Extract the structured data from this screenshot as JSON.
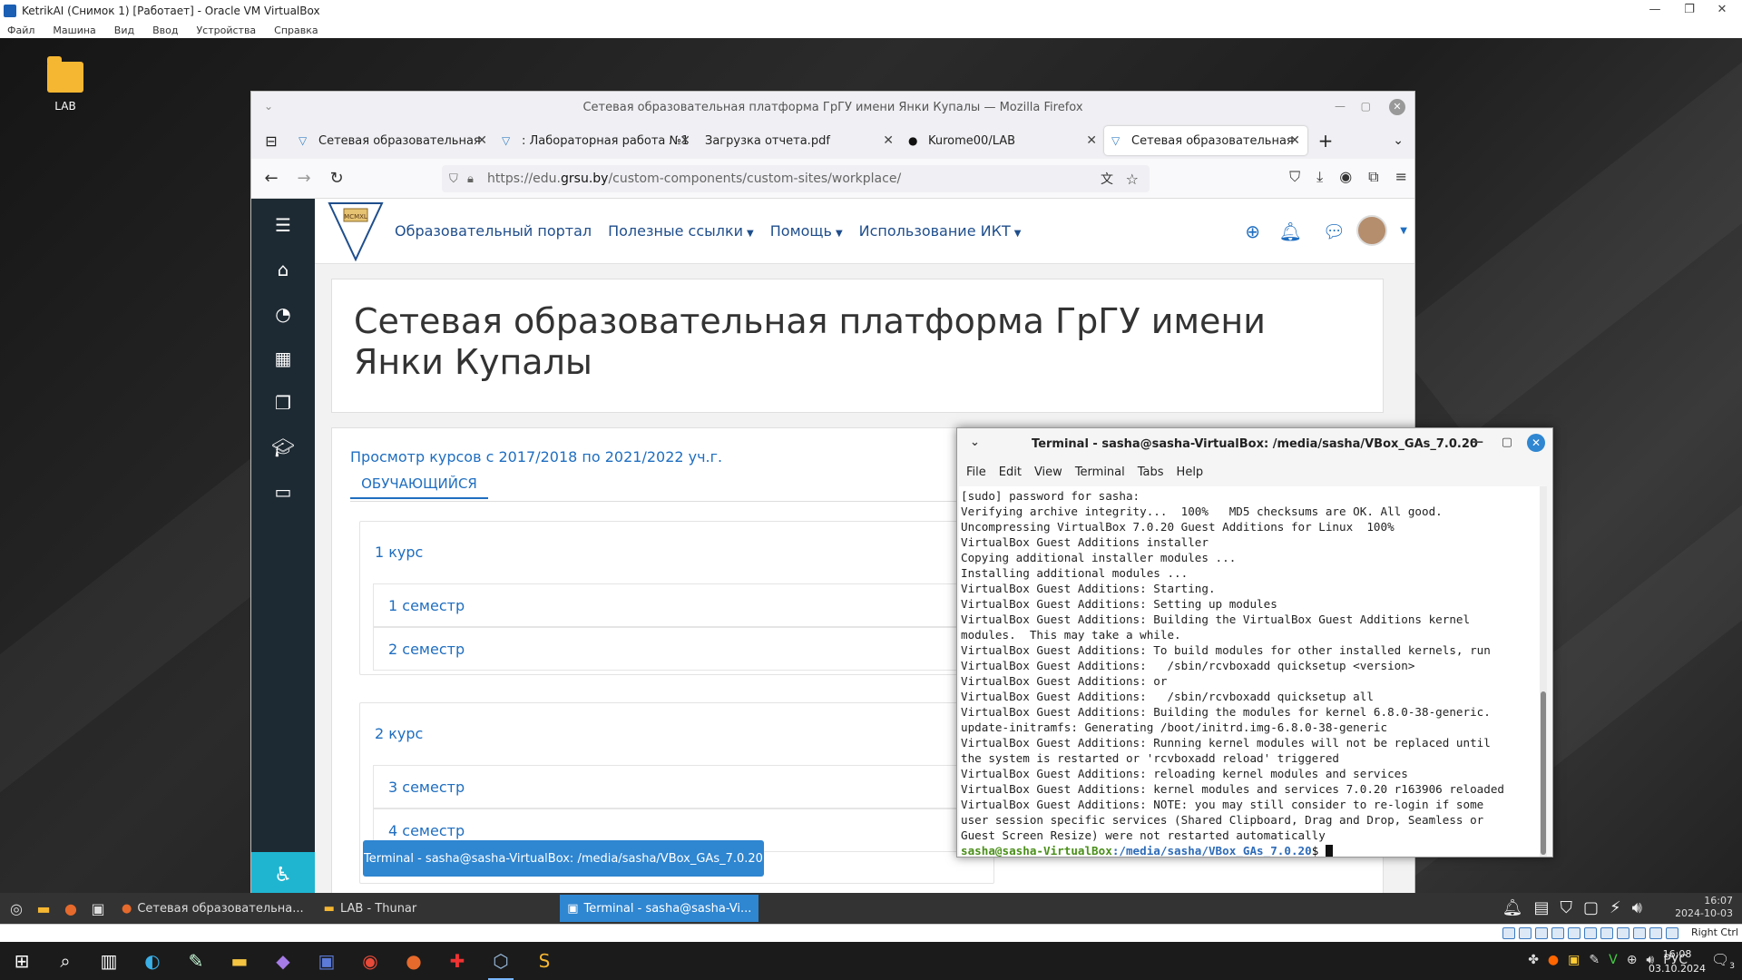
{
  "vbox": {
    "title": "KetrikAI (Снимок 1) [Работает] - Oracle VM VirtualBox",
    "menu": [
      "Файл",
      "Машина",
      "Вид",
      "Ввод",
      "Устройства",
      "Справка"
    ],
    "host_key": "Right Ctrl"
  },
  "desktop": {
    "icon_label": "LAB"
  },
  "firefox": {
    "window_title": "Сетевая образовательная платформа ГрГУ имени Янки Купалы — Mozilla Firefox",
    "tabs": [
      {
        "label": "Сетевая образовательная"
      },
      {
        "label": ": Лабораторная работа №1"
      },
      {
        "label": "Загрузка отчета.pdf"
      },
      {
        "label": "Kurome00/LAB"
      },
      {
        "label": "Сетевая образовательная"
      }
    ],
    "url_prefix": "https://edu.",
    "url_domain": "grsu.by",
    "url_path": "/custom-components/custom-sites/workplace/"
  },
  "site": {
    "logo_text": "MCMXL",
    "nav": [
      {
        "label": "Образовательный портал",
        "dropdown": false
      },
      {
        "label": "Полезные ссылки",
        "dropdown": true
      },
      {
        "label": "Помощь",
        "dropdown": true
      },
      {
        "label": "Использование ИКТ",
        "dropdown": true
      }
    ],
    "page_title": "Сетевая образовательная платформа ГрГУ имени Янки Купалы",
    "view_courses_link": "Просмотр курсов с 2017/2018 по 2021/2022 уч.г.",
    "tab_label": "ОБУЧАЮЩИЙСЯ",
    "courses": [
      {
        "title": "1 курс",
        "semesters": [
          "1 семестр",
          "2 семестр"
        ]
      },
      {
        "title": "2 курс",
        "semesters": [
          "3 семестр",
          "4 семестр"
        ]
      }
    ]
  },
  "terminal": {
    "title": "Terminal - sasha@sasha-VirtualBox: /media/sasha/VBox_GAs_7.0.20",
    "menu": [
      "File",
      "Edit",
      "View",
      "Terminal",
      "Tabs",
      "Help"
    ],
    "output": "[sudo] password for sasha:\nVerifying archive integrity...  100%   MD5 checksums are OK. All good.\nUncompressing VirtualBox 7.0.20 Guest Additions for Linux  100%\nVirtualBox Guest Additions installer\nCopying additional installer modules ...\nInstalling additional modules ...\nVirtualBox Guest Additions: Starting.\nVirtualBox Guest Additions: Setting up modules\nVirtualBox Guest Additions: Building the VirtualBox Guest Additions kernel\nmodules.  This may take a while.\nVirtualBox Guest Additions: To build modules for other installed kernels, run\nVirtualBox Guest Additions:   /sbin/rcvboxadd quicksetup <version>\nVirtualBox Guest Additions: or\nVirtualBox Guest Additions:   /sbin/rcvboxadd quicksetup all\nVirtualBox Guest Additions: Building the modules for kernel 6.8.0-38-generic.\nupdate-initramfs: Generating /boot/initrd.img-6.8.0-38-generic\nVirtualBox Guest Additions: Running kernel modules will not be replaced until\nthe system is restarted or 'rcvboxadd reload' triggered\nVirtualBox Guest Additions: reloading kernel modules and services\nVirtualBox Guest Additions: kernel modules and services 7.0.20 r163906 reloaded\nVirtualBox Guest Additions: NOTE: you may still consider to re-login if some\nuser session specific services (Shared Clipboard, Drag and Drop, Seamless or\nGuest Screen Resize) were not restarted automatically",
    "prompt_user": "sasha@sasha-VirtualBox",
    "prompt_path": ":/media/sasha/VBox_GAs_7.0.20",
    "prompt_sym": "$"
  },
  "tooltip": "Terminal - sasha@sasha-VirtualBox: /media/sasha/VBox_GAs_7.0.20",
  "guest_panel": {
    "tasks": [
      "Сетевая образовательна...",
      "LAB - Thunar",
      "Terminal - sasha@sasha-Vi..."
    ],
    "time": "16:07",
    "date": "2024-10-03"
  },
  "windows_taskbar": {
    "lang": "РУС",
    "time": "16:08",
    "date": "03.10.2024",
    "notif_count": "3"
  }
}
